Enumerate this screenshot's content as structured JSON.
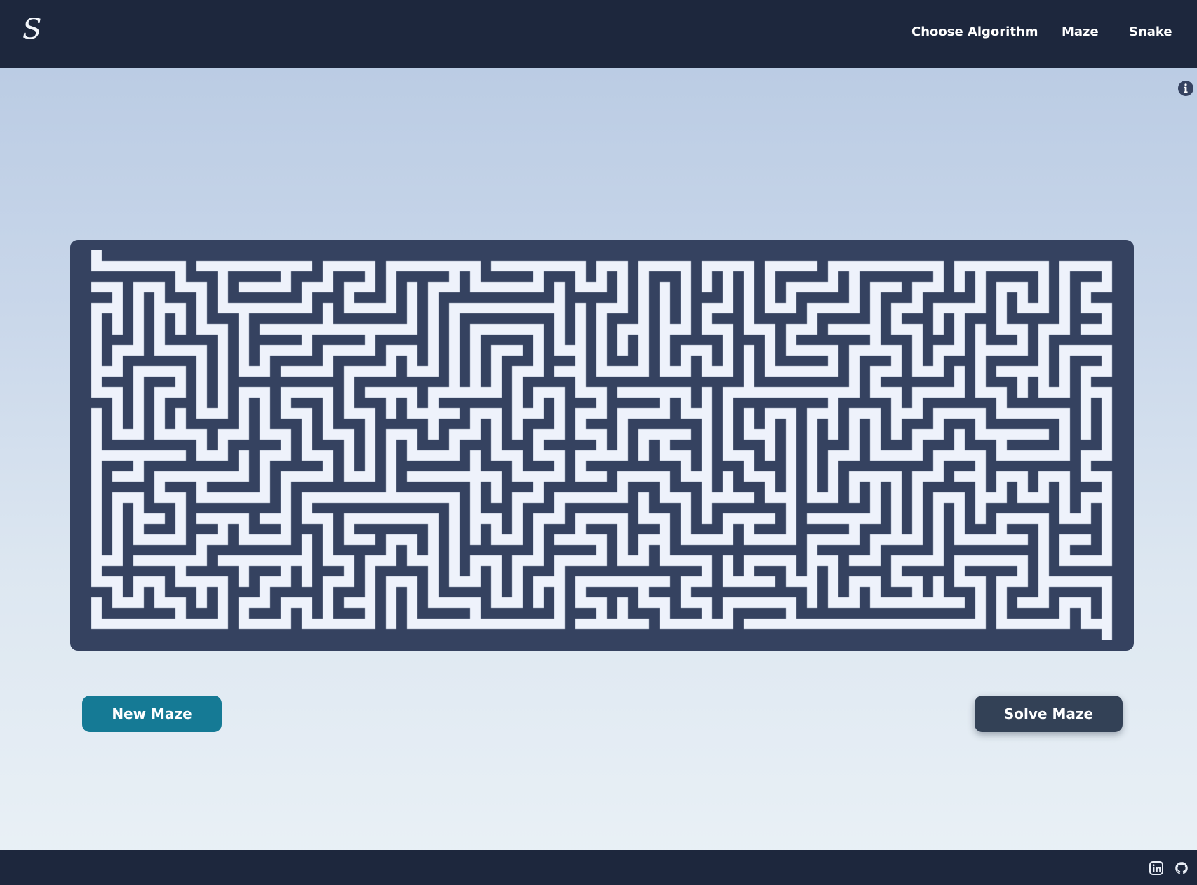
{
  "header": {
    "logo": "S",
    "nav": [
      {
        "label": "Choose Algorithm"
      },
      {
        "label": "Maze"
      },
      {
        "label": "Snake"
      }
    ]
  },
  "info": {
    "icon": "info-icon"
  },
  "maze": {
    "wall_color": "#354260",
    "path_color": "#eef2fb",
    "columns": 99,
    "rows": 37
  },
  "actions": {
    "new_maze_label": "New Maze",
    "solve_maze_label": "Solve Maze"
  },
  "footer": {
    "icons": [
      "linkedin-icon",
      "github-icon"
    ]
  },
  "colors": {
    "nav_background": "#1d273d",
    "primary_button": "#157a95",
    "secondary_button": "#334156"
  }
}
